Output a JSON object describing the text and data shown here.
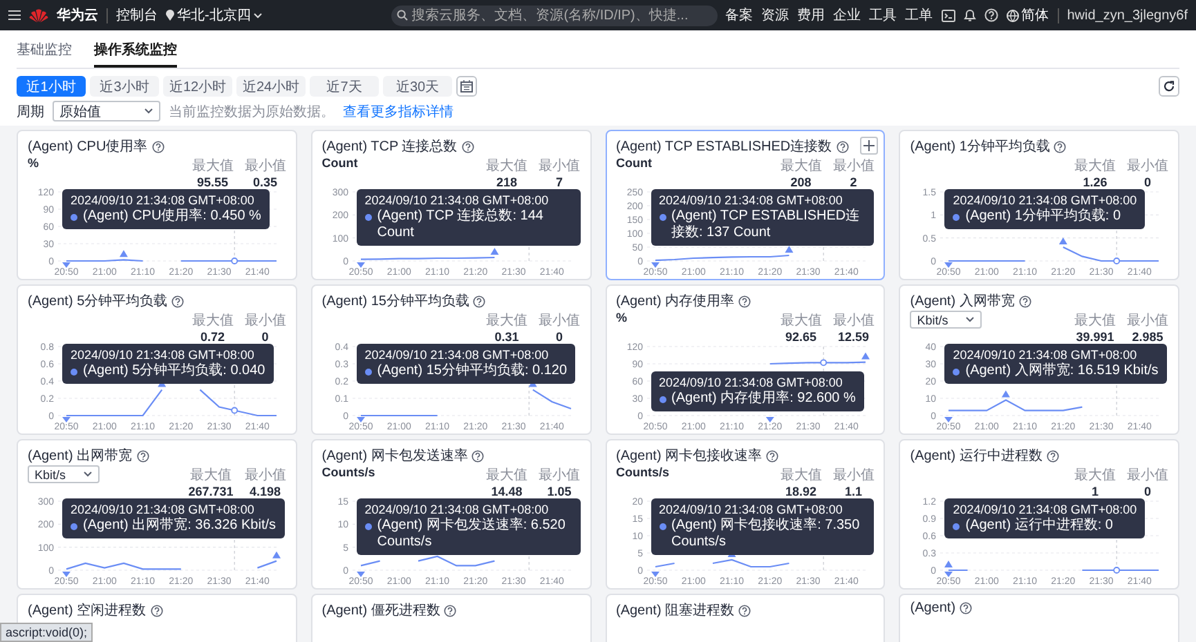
{
  "topbar": {
    "brand": "华为云",
    "console": "控制台",
    "region": "华北-北京四",
    "search": {
      "placeholder": "搜索云服务、文档、资源(名称/ID/IP)、快捷..."
    },
    "links": [
      "备案",
      "资源",
      "费用",
      "企业",
      "工具",
      "工单"
    ],
    "language": "简体",
    "user": "hwid_zyn_3jlegny6f"
  },
  "tabs": [
    {
      "label": "基础监控",
      "selected": false
    },
    {
      "label": "操作系统监控",
      "selected": true
    }
  ],
  "ranges": [
    {
      "label": "近1小时",
      "selected": true
    },
    {
      "label": "近3小时",
      "selected": false
    },
    {
      "label": "近12小时",
      "selected": false
    },
    {
      "label": "近24小时",
      "selected": false
    },
    {
      "label": "近7天",
      "selected": false
    },
    {
      "label": "近30天",
      "selected": false
    }
  ],
  "period": {
    "label": "周期",
    "value": "原始值",
    "hint": "当前监控数据为原始数据。",
    "link": "查看更多指标详情"
  },
  "cards": [
    {
      "title": "(Agent) CPU使用率",
      "unit": "%",
      "selected": false,
      "max_label": "最大值",
      "max": "95.55",
      "min_label": "最小值",
      "min": "0.35",
      "tooltip": {
        "time": "2024/09/10 21:34:08 GMT+08:00",
        "text": "(Agent) CPU使用率: 0.450 %"
      },
      "chart_data": {
        "type": "line",
        "grid": true,
        "categories": [
          "20:50",
          null,
          "21:00",
          null,
          "21:10",
          null,
          "21:20",
          null,
          "21:30",
          null,
          "21:40",
          null
        ],
        "ylim": [
          0,
          120
        ],
        "yticks": [
          0,
          30,
          60,
          90,
          120
        ],
        "series": [
          {
            "color": "#6a8df5",
            "values": [
              0,
              0,
              0,
              2,
              0,
              null,
              0,
              0,
              0,
              0,
              0,
              0
            ]
          }
        ]
      }
    },
    {
      "title": "(Agent) TCP 连接总数",
      "unit": "Count",
      "selected": false,
      "max_label": "最大值",
      "max": "218",
      "min_label": "最小值",
      "min": "7",
      "tooltip": {
        "time": "2024/09/10 21:34:08 GMT+08:00",
        "text": "(Agent) TCP 连接总数: 144 Count"
      },
      "chart_data": {
        "type": "line",
        "grid": true,
        "categories": [
          "20:50",
          null,
          "21:00",
          null,
          "21:10",
          null,
          "21:20",
          null,
          "21:30",
          null,
          "21:40",
          null
        ],
        "ylim": [
          0,
          300
        ],
        "yticks": [
          0,
          100,
          200,
          300
        ],
        "series": [
          {
            "color": "#6a8df5",
            "values": [
              7,
              8,
              10,
              10,
              12,
              12,
              13,
              15,
              null,
              null,
              null,
              null
            ]
          }
        ]
      }
    },
    {
      "title": "(Agent) TCP ESTABLISHED连接数",
      "unit": "Count",
      "selected": true,
      "max_label": "最大值",
      "max": "208",
      "min_label": "最小值",
      "min": "2",
      "tooltip": {
        "time": "2024/09/10 21:34:08 GMT+08:00",
        "text": "(Agent) TCP ESTABLISHED连接数: 137 Count"
      },
      "chart_data": {
        "type": "line",
        "grid": true,
        "categories": [
          "20:50",
          null,
          "21:00",
          null,
          "21:10",
          null,
          "21:20",
          null,
          "21:30",
          null,
          "21:40",
          null
        ],
        "ylim": [
          0,
          250
        ],
        "yticks": [
          0,
          50,
          100,
          150,
          200,
          250
        ],
        "series": [
          {
            "color": "#6a8df5",
            "values": [
              2,
              5,
              10,
              12,
              14,
              15,
              15,
              20,
              null,
              null,
              null,
              null
            ]
          }
        ]
      }
    },
    {
      "title": "(Agent) 1分钟平均负载",
      "selected": false,
      "max_label": "最大值",
      "max": "1.26",
      "min_label": "最小值",
      "min": "0",
      "tooltip": {
        "time": "2024/09/10 21:34:08 GMT+08:00",
        "text": "(Agent) 1分钟平均负载: 0"
      },
      "chart_data": {
        "type": "line",
        "grid": true,
        "categories": [
          "20:50",
          null,
          "21:00",
          null,
          "21:10",
          null,
          "21:20",
          null,
          "21:30",
          null,
          "21:40",
          null
        ],
        "ylim": [
          0,
          1.5
        ],
        "yticks": [
          0,
          0.5,
          1,
          1.5
        ],
        "series": [
          {
            "color": "#6a8df5",
            "values": [
              0,
              0,
              0,
              0,
              0,
              null,
              0.3,
              0.1,
              0,
              0,
              0,
              0
            ]
          }
        ]
      }
    },
    {
      "title": "(Agent) 5分钟平均负载",
      "selected": false,
      "max_label": "最大值",
      "max": "0.72",
      "min_label": "最小值",
      "min": "0",
      "tooltip": {
        "time": "2024/09/10 21:34:08 GMT+08:00",
        "text": "(Agent) 5分钟平均负载: 0.040"
      },
      "chart_data": {
        "type": "line",
        "grid": true,
        "categories": [
          "20:50",
          null,
          "21:00",
          null,
          "21:10",
          null,
          "21:20",
          null,
          "21:30",
          null,
          "21:40",
          null
        ],
        "ylim": [
          0,
          0.8
        ],
        "yticks": [
          0,
          0.2,
          0.4,
          0.6,
          0.8
        ],
        "series": [
          {
            "color": "#6a8df5",
            "values": [
              0,
              0,
              0,
              0,
              0,
              0.3,
              null,
              0.3,
              0.1,
              0.05,
              0,
              0
            ]
          }
        ]
      }
    },
    {
      "title": "(Agent) 15分钟平均负载",
      "selected": false,
      "max_label": "最大值",
      "max": "0.31",
      "min_label": "最小值",
      "min": "0",
      "tooltip": {
        "time": "2024/09/10 21:34:08 GMT+08:00",
        "text": "(Agent) 15分钟平均负载: 0.120"
      },
      "chart_data": {
        "type": "line",
        "grid": true,
        "categories": [
          "20:50",
          null,
          "21:00",
          null,
          "21:10",
          null,
          "21:20",
          null,
          "21:30",
          null,
          "21:40",
          null
        ],
        "ylim": [
          0,
          0.4
        ],
        "yticks": [
          0,
          0.1,
          0.2,
          0.3,
          0.4
        ],
        "series": [
          {
            "color": "#6a8df5",
            "values": [
              0,
              0,
              0,
              0,
              0,
              null,
              null,
              null,
              null,
              0.15,
              0.08,
              0.04
            ]
          }
        ]
      }
    },
    {
      "title": "(Agent) 内存使用率",
      "unit": "%",
      "selected": false,
      "max_label": "最大值",
      "max": "92.65",
      "min_label": "最小值",
      "min": "12.59",
      "tooltip": {
        "time": "2024/09/10 21:34:08 GMT+08:00",
        "text": "(Agent) 内存使用率: 92.600 %"
      },
      "chart_data": {
        "type": "line",
        "grid": true,
        "categories": [
          "20:50",
          null,
          "21:00",
          null,
          "21:10",
          null,
          "21:20",
          null,
          "21:30",
          null,
          "21:40",
          null
        ],
        "ylim": [
          0,
          120
        ],
        "yticks": [
          0,
          30,
          60,
          90,
          120
        ],
        "series": [
          {
            "color": "#6a8df5",
            "values": [
              null,
              null,
              null,
              null,
              null,
              null,
              90,
              91,
              92,
              92,
              92,
              93
            ]
          }
        ]
      }
    },
    {
      "title": "(Agent) 入网带宽",
      "unit_select": "Kbit/s",
      "selected": false,
      "max_label": "最大值",
      "max": "39.991",
      "min_label": "最小值",
      "min": "2.985",
      "tooltip": {
        "time": "2024/09/10 21:34:08 GMT+08:00",
        "text": "(Agent) 入网带宽: 16.519 Kbit/s"
      },
      "chart_data": {
        "type": "line",
        "grid": true,
        "categories": [
          "20:50",
          null,
          "21:00",
          null,
          "21:10",
          null,
          "21:20",
          null,
          "21:30",
          null,
          "21:40",
          null
        ],
        "ylim": [
          0,
          40
        ],
        "yticks": [
          0,
          10,
          20,
          30,
          40
        ],
        "series": [
          {
            "color": "#6a8df5",
            "values": [
              3,
              3,
              3,
              9,
              3,
              3,
              3,
              5,
              null,
              null,
              null,
              null
            ]
          }
        ]
      }
    },
    {
      "title": "(Agent) 出网带宽",
      "unit_select": "Kbit/s",
      "selected": false,
      "max_label": "最大值",
      "max": "267.731",
      "min_label": "最小值",
      "min": "4.198",
      "tooltip": {
        "time": "2024/09/10 21:34:08 GMT+08:00",
        "text": "(Agent) 出网带宽: 36.326 Kbit/s"
      },
      "chart_data": {
        "type": "line",
        "grid": true,
        "categories": [
          "20:50",
          null,
          "21:00",
          null,
          "21:10",
          null,
          "21:20",
          null,
          "21:30",
          null,
          "21:40",
          null
        ],
        "ylim": [
          0,
          300
        ],
        "yticks": [
          0,
          100,
          200,
          300
        ],
        "series": [
          {
            "color": "#6a8df5",
            "values": [
              5,
              30,
              10,
              30,
              5,
              5,
              5,
              null,
              null,
              null,
              10,
              40
            ]
          }
        ]
      }
    },
    {
      "title": "(Agent) 网卡包发送速率",
      "unit": "Counts/s",
      "selected": false,
      "max_label": "最大值",
      "max": "14.48",
      "min_label": "最小值",
      "min": "1.05",
      "tooltip": {
        "time": "2024/09/10 21:34:08 GMT+08:00",
        "text": "(Agent) 网卡包发送速率: 6.520 Counts/s"
      },
      "chart_data": {
        "type": "line",
        "grid": true,
        "categories": [
          "20:50",
          null,
          "21:00",
          null,
          "21:10",
          null,
          "21:20",
          null,
          "21:30",
          null,
          "21:40",
          null
        ],
        "ylim": [
          0,
          15
        ],
        "yticks": [
          0,
          5,
          10,
          15
        ],
        "series": [
          {
            "color": "#6a8df5",
            "values": [
              1,
              2,
              null,
              2,
              3,
              1,
              1,
              2,
              null,
              null,
              null,
              null
            ]
          }
        ]
      }
    },
    {
      "title": "(Agent) 网卡包接收速率",
      "unit": "Counts/s",
      "selected": false,
      "max_label": "最大值",
      "max": "18.92",
      "min_label": "最小值",
      "min": "1.1",
      "tooltip": {
        "time": "2024/09/10 21:34:08 GMT+08:00",
        "text": "(Agent) 网卡包接收速率: 7.350 Counts/s"
      },
      "chart_data": {
        "type": "line",
        "grid": true,
        "categories": [
          "20:50",
          null,
          "21:00",
          null,
          "21:10",
          null,
          "21:20",
          null,
          "21:30",
          null,
          "21:40",
          null
        ],
        "ylim": [
          0,
          20
        ],
        "yticks": [
          0,
          5,
          10,
          15,
          20
        ],
        "series": [
          {
            "color": "#6a8df5",
            "values": [
              1,
              2,
              null,
              2,
              3,
              1,
              1,
              2,
              null,
              null,
              null,
              null
            ]
          }
        ]
      }
    },
    {
      "title": "(Agent) 运行中进程数",
      "selected": false,
      "max_label": "最大值",
      "max": "1",
      "min_label": "最小值",
      "min": "0",
      "tooltip": {
        "time": "2024/09/10 21:34:08 GMT+08:00",
        "text": "(Agent) 运行中进程数: 0"
      },
      "chart_data": {
        "type": "line",
        "grid": true,
        "categories": [
          "20:50",
          null,
          "21:00",
          null,
          "21:10",
          null,
          "21:20",
          null,
          "21:30",
          null,
          "21:40",
          null
        ],
        "ylim": [
          0,
          1.2
        ],
        "yticks": [
          0,
          0.3,
          0.6,
          0.9,
          1.2
        ],
        "series": [
          {
            "color": "#6a8df5",
            "values": [
              0,
              0,
              null,
              null,
              null,
              null,
              null,
              0,
              0,
              0,
              0,
              0
            ]
          }
        ]
      }
    },
    {
      "title": "(Agent) 空闲进程数",
      "selected": false
    },
    {
      "title": "(Agent) 僵死进程数",
      "selected": false
    },
    {
      "title": "(Agent) 阻塞进程数",
      "selected": false
    },
    {
      "title": "(Agent)",
      "selected": false
    }
  ],
  "status_text": "ascript:void(0);"
}
